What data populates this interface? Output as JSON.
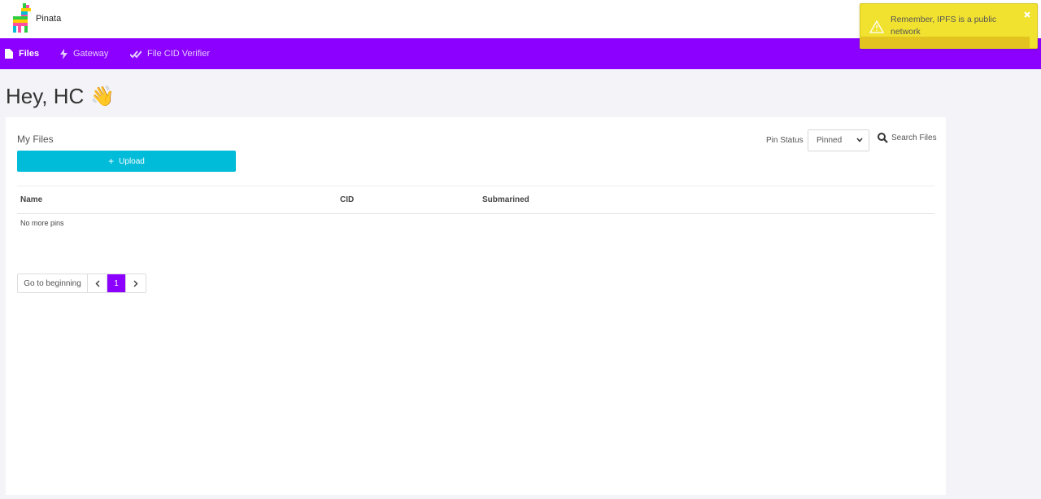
{
  "header": {
    "brand": "Pinata",
    "logo_icon": "llama-pinata-icon"
  },
  "nav": {
    "files_label": "Files",
    "gateway_label": "Gateway",
    "verifier_label": "File CID Verifier",
    "accent_color": "#8b00ff"
  },
  "greeting": {
    "text": "Hey, HC",
    "emoji": "👋"
  },
  "files_card": {
    "title": "My Files",
    "upload_plus": "+",
    "upload_label": "Upload",
    "pin_status_label": "Pin Status",
    "pin_status_value": "Pinned",
    "search_label": "Search Files",
    "columns": [
      "Name",
      "CID",
      "Submarined"
    ],
    "empty_text": "No more pins"
  },
  "pagination": {
    "begin_label": "Go to beginning",
    "prev_symbol": "‹",
    "current_page": "1",
    "next_symbol": "›"
  },
  "toast": {
    "message": "Remember, IPFS is a public network",
    "progress": 0.96,
    "color": "#f1e230"
  }
}
